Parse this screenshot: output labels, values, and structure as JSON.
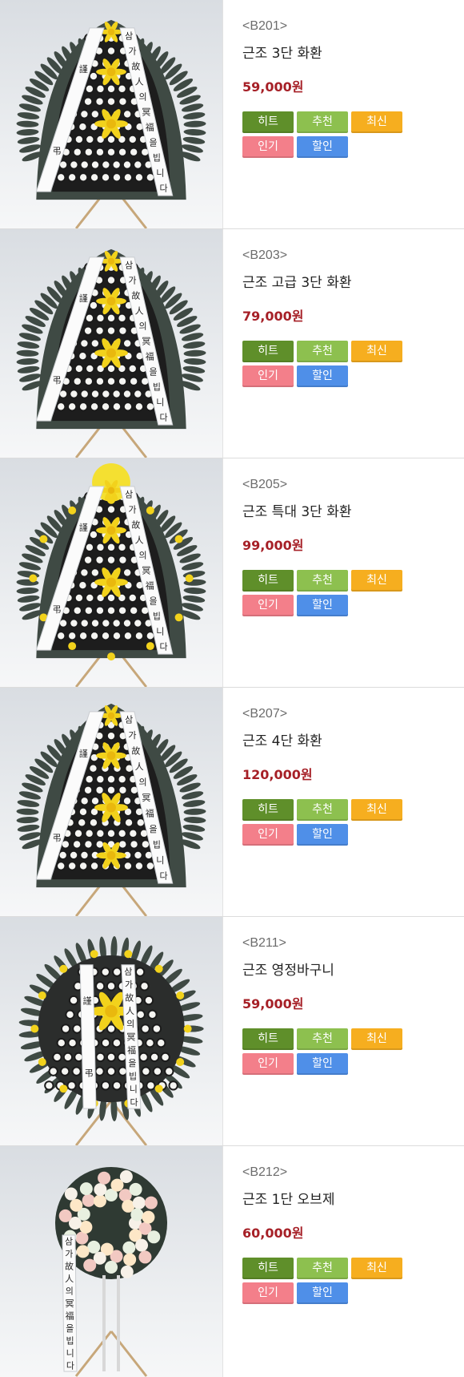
{
  "products": [
    {
      "code": "<B201>",
      "name": "근조 3단 화환",
      "price": "59,000원",
      "style": "tri"
    },
    {
      "code": "<B203>",
      "name": "근조 고급 3단 화환",
      "price": "79,000원",
      "style": "tri"
    },
    {
      "code": "<B205>",
      "name": "근조 특대 3단 화환",
      "price": "99,000원",
      "style": "big"
    },
    {
      "code": "<B207>",
      "name": "근조 4단 화환",
      "price": "120,000원",
      "style": "four"
    },
    {
      "code": "<B211>",
      "name": "근조 영정바구니",
      "price": "59,000원",
      "style": "round"
    },
    {
      "code": "<B212>",
      "name": "근조 1단 오브제",
      "price": "60,000원",
      "style": "obj"
    }
  ],
  "badges": {
    "hit": "히트",
    "recommend": "추천",
    "new": "최신",
    "popular": "인기",
    "sale": "할인"
  },
  "ribbon": {
    "left": "謹弔",
    "right": "삼가故人의冥福을빕니다"
  },
  "colors": {
    "price": "#a62027",
    "hit": "#5f8f2a",
    "recommend": "#8dc04f",
    "new": "#f6ae1f",
    "popular": "#f37f8a",
    "sale": "#4f8fe8"
  }
}
